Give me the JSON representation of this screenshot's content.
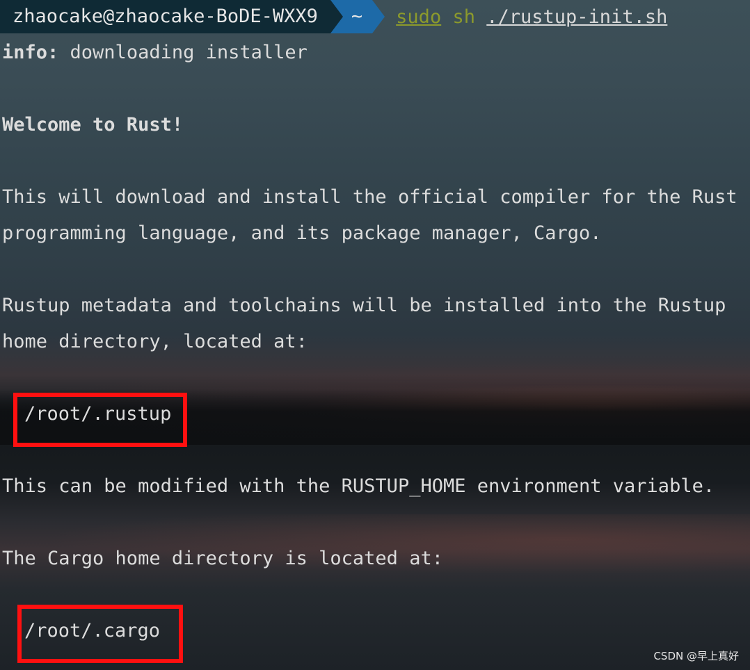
{
  "prompt": {
    "user_host": "zhaocake@zhaocake-BoDE-WXX9",
    "directory": "~",
    "command_sudo": "sudo",
    "command_sh": "sh",
    "command_script": "./rustup-init.sh"
  },
  "output": {
    "info_label": "info:",
    "info_text": " downloading installer",
    "welcome": "Welcome to Rust!",
    "intro_line1": "This will download and install the official compiler for the Rust",
    "intro_line2": "programming language, and its package manager, Cargo.",
    "rustup_line1": "Rustup metadata and toolchains will be installed into the Rustup",
    "rustup_line2": "home directory, located at:",
    "rustup_path": "/root/.rustup",
    "rustup_env": "This can be modified with the RUSTUP_HOME environment variable.",
    "cargo_line": "The Cargo home directory is located at:",
    "cargo_path": "/root/.cargo"
  },
  "watermark": "CSDN @早上真好",
  "colors": {
    "highlight_box": "#ff1010",
    "prompt_user_bg": "#0f2a35",
    "prompt_dir_bg": "#1d6aa8",
    "command_green": "#8c9a2c"
  }
}
